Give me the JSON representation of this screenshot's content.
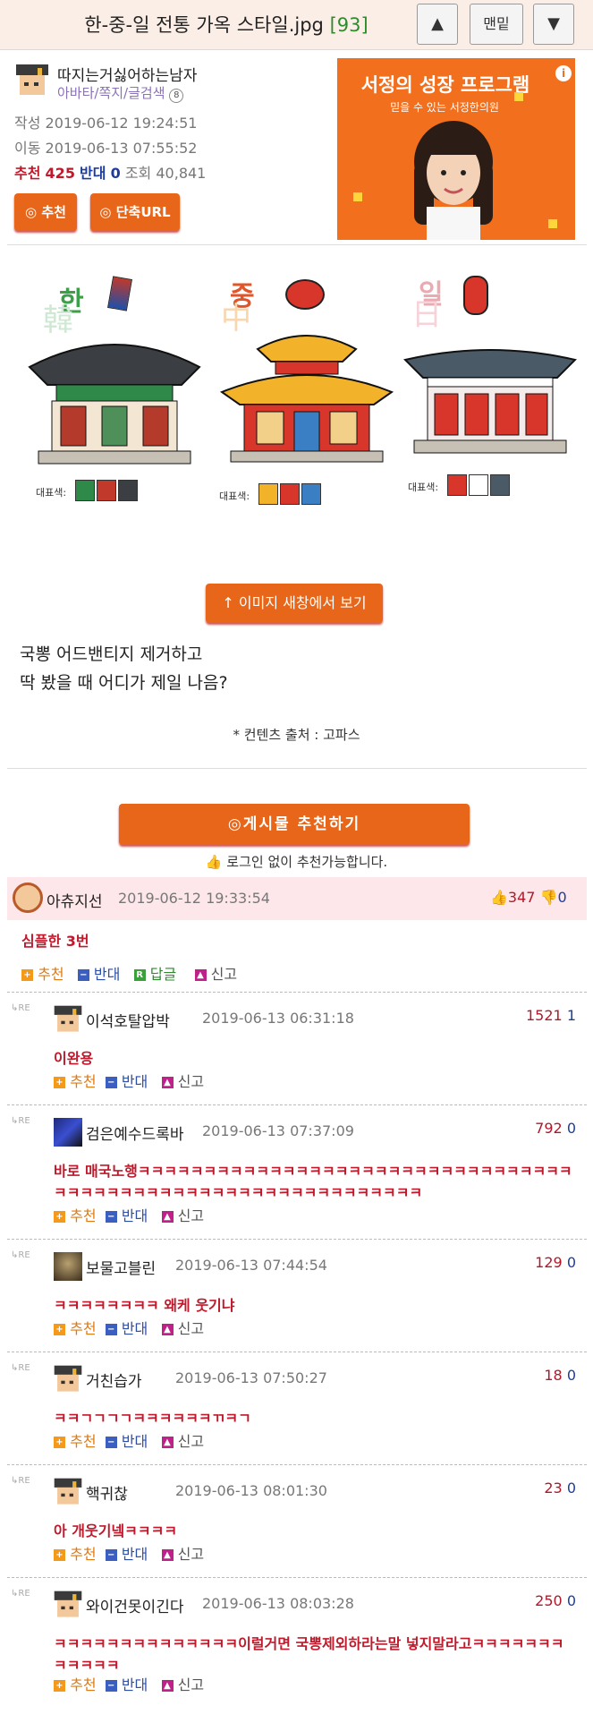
{
  "header": {
    "title": "한-중-일 전통 가옥 스타일.jpg",
    "count": "[93]",
    "up_label": "▲",
    "bottom_label": "맨밑",
    "down_label": "▼"
  },
  "author": {
    "name": "따지는거싫어하는남자",
    "links": "아바타/쪽지/글검색",
    "level": "8",
    "written_label": "작성",
    "written": "2019-06-12 19:24:51",
    "moved_label": "이동",
    "moved": "2019-06-13 07:55:52",
    "recommend_label": "추천",
    "recommend": "425",
    "oppose_label": "반대",
    "oppose": "0",
    "views_label": "조회",
    "views": "40,841",
    "btn_recommend": "추천",
    "btn_short": "단축URL"
  },
  "ad": {
    "headline": "서정의 성장 프로그램",
    "sub": "믿을 수 있는 서정한의원",
    "info": "i"
  },
  "post": {
    "houses": [
      {
        "label": "한",
        "bg": "韓",
        "swatch_label": "대표색:",
        "colors": [
          "#2f8a4a",
          "#c0392b",
          "#3b3f44"
        ]
      },
      {
        "label": "중",
        "bg": "中",
        "swatch_label": "대표색:",
        "colors": [
          "#f2b32a",
          "#d8362b",
          "#3a7fc4"
        ]
      },
      {
        "label": "일",
        "bg": "日",
        "swatch_label": "대표색:",
        "colors": [
          "#d8362b",
          "#ffffff",
          "#4a5a66"
        ]
      }
    ],
    "view_image_btn": "↑ 이미지 새창에서 보기",
    "body_line1": "국뽕 어드밴티지 제거하고",
    "body_line2": "딱 봤을 때 어디가 제일 나음?",
    "source": "* 컨텐츠 출처 : 고파스",
    "recommend_btn": "◎게시물 추천하기",
    "login_note": "로그인 없이 추천가능합니다."
  },
  "actions": {
    "recommend": "추천",
    "oppose": "반대",
    "reply": "답글",
    "report": "신고",
    "re": "RE"
  },
  "top_comment": {
    "name": "아츄지선",
    "date": "2019-06-12 19:33:54",
    "up": "347",
    "down": "0",
    "text": "심플한 3번"
  },
  "replies": [
    {
      "name": "이석호탈압박",
      "date": "2019-06-13 06:31:18",
      "up": "1521",
      "down": "1",
      "text": "이완용",
      "avatar": "cap"
    },
    {
      "name": "검은예수드록바",
      "date": "2019-06-13 07:37:09",
      "up": "792",
      "down": "0",
      "text": "바로 매국노행ㅋㅋㅋㅋㅋㅋㅋㅋㅋㅋㅋㅋㅋㅋㅋㅋㅋㅋㅋㅋㅋㅋㅋㅋㅋㅋㅋㅋㅋㅋㅋㅋㅋㅋㅋㅋㅋㅋㅋㅋㅋㅋㅋㅋㅋㅋㅋㅋㅋㅋㅋㅋㅋㅋㅋㅋㅋㅋㅋㅋㅋ",
      "avatar": "blue"
    },
    {
      "name": "보물고블린",
      "date": "2019-06-13 07:44:54",
      "up": "129",
      "down": "0",
      "text": "ㅋㅋㅋㅋㅋㅋㅋㅋ 왜케 웃기냐",
      "avatar": "goblin"
    },
    {
      "name": "거친습가",
      "date": "2019-06-13 07:50:27",
      "up": "18",
      "down": "0",
      "text": "ㅋㅋㄱㄱㄱㄱㅋㅋㅋㅋㅋㅋㄲㅋㄱ",
      "avatar": "cap"
    },
    {
      "name": "핵귀찮",
      "date": "2019-06-13 08:01:30",
      "up": "23",
      "down": "0",
      "text": "아 개웃기넼ㅋㅋㅋㅋ",
      "avatar": "cap"
    },
    {
      "name": "와이건못이긴다",
      "date": "2019-06-13 08:03:28",
      "up": "250",
      "down": "0",
      "text": "ㅋㅋㅋㅋㅋㅋㅋㅋㅋㅋㅋㅋㅋㅋ이럴거면 국뽕제외하라는말 넣지말라고ㅋㅋㅋㅋㅋㅋㅋㅋㅋㅋㅋㅋ",
      "avatar": "cap"
    }
  ]
}
